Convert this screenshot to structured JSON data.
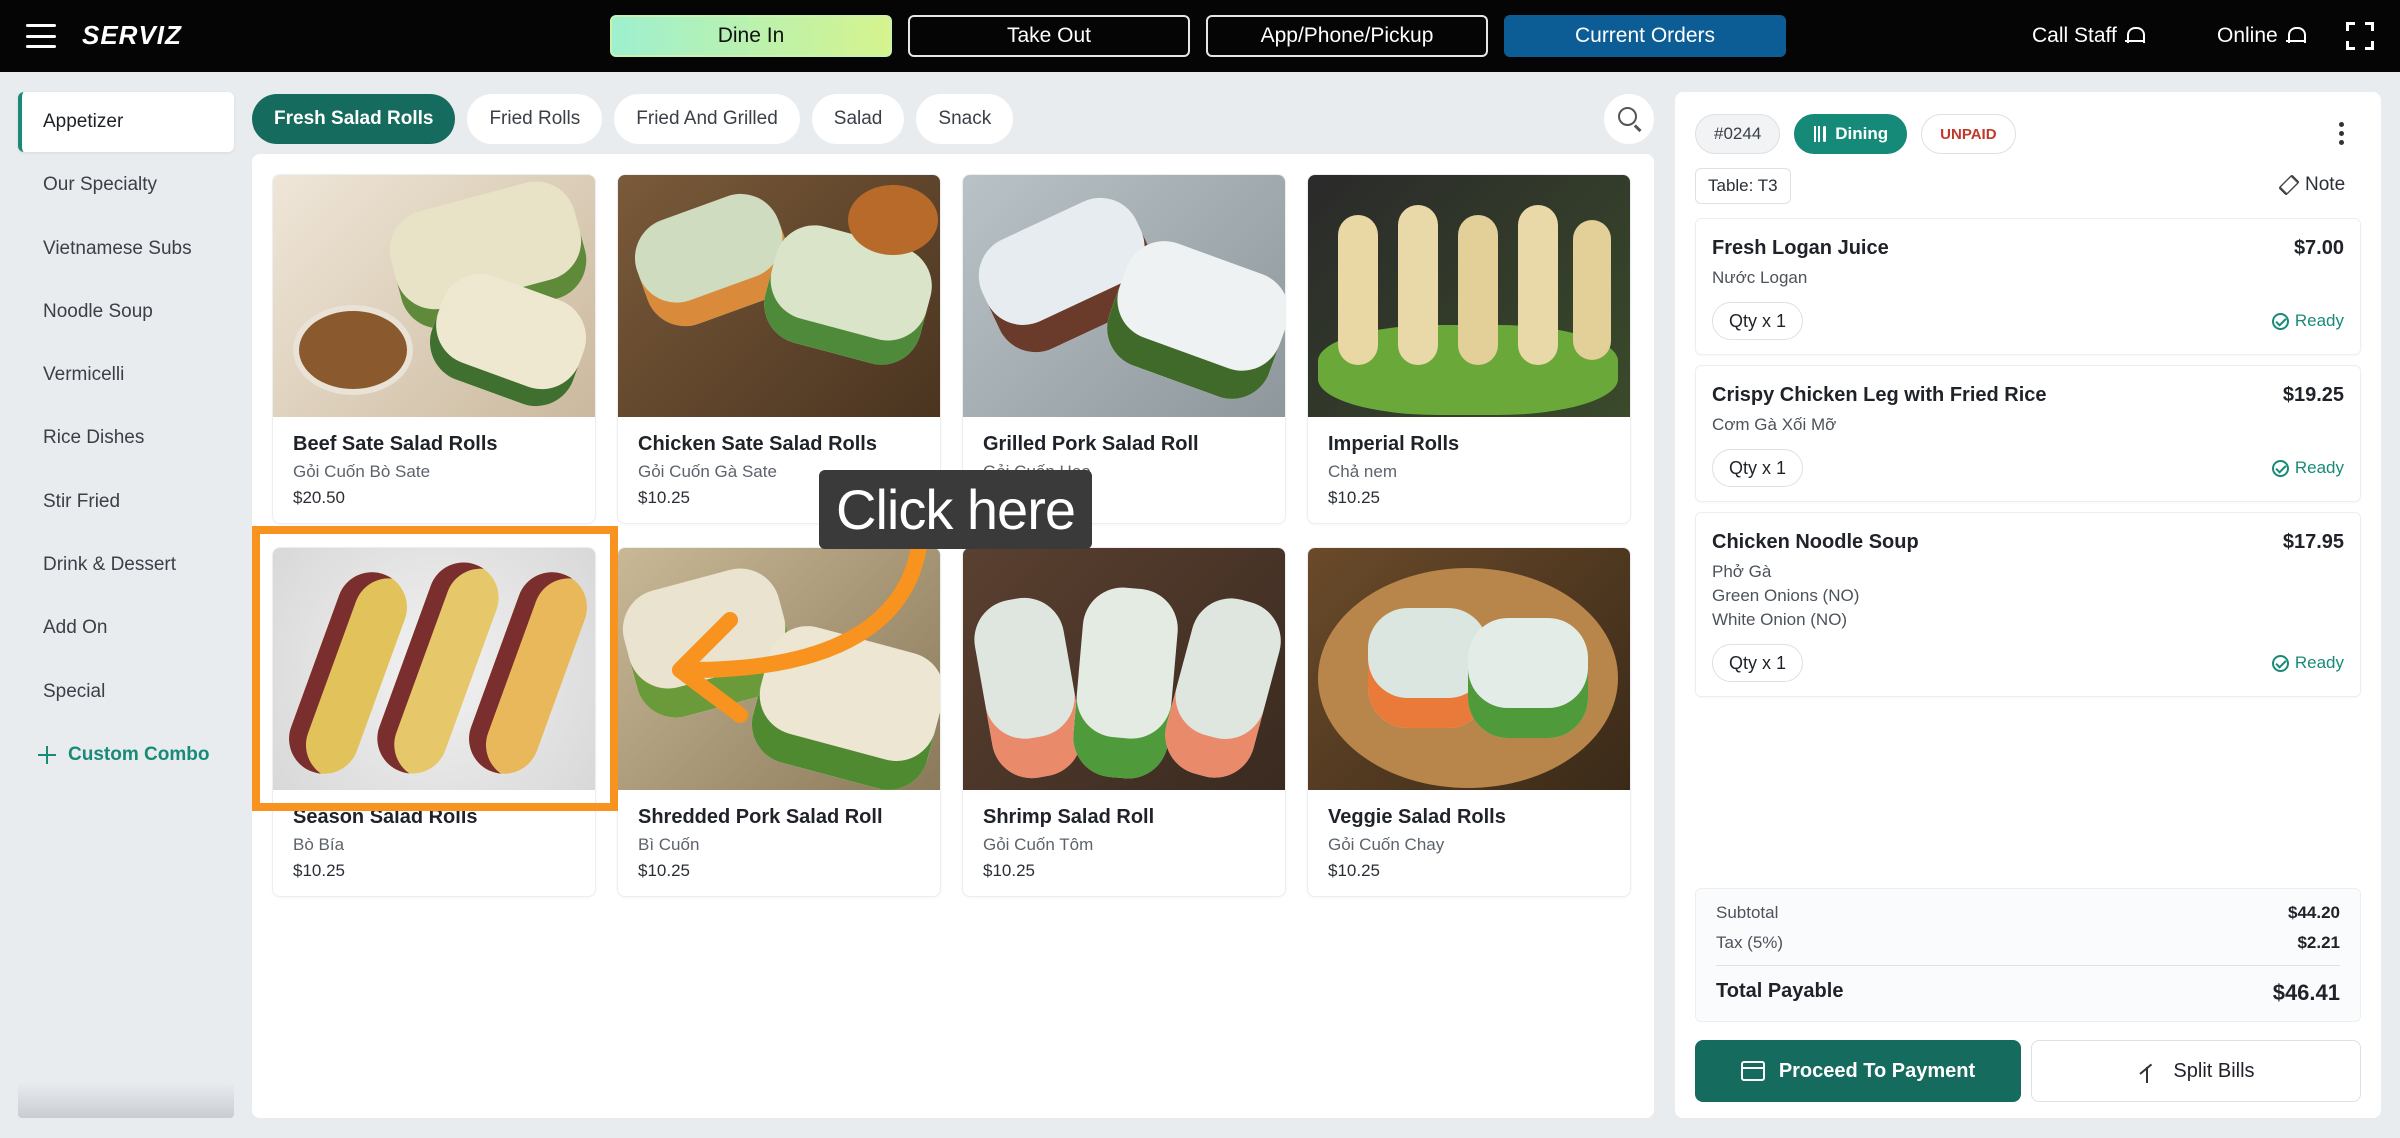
{
  "header": {
    "brand": "SERVIZ",
    "tabs": [
      {
        "label": "Dine In",
        "active": true
      },
      {
        "label": "Take Out",
        "active": false
      },
      {
        "label": "App/Phone/Pickup",
        "active": false
      },
      {
        "label": "Current Orders",
        "active": false
      }
    ],
    "call_staff": "Call Staff",
    "online": "Online"
  },
  "sidebar": {
    "items": [
      {
        "label": "Appetizer",
        "active": true
      },
      {
        "label": "Our Specialty"
      },
      {
        "label": "Vietnamese Subs"
      },
      {
        "label": "Noodle Soup"
      },
      {
        "label": "Vermicelli"
      },
      {
        "label": "Rice Dishes"
      },
      {
        "label": "Stir Fried"
      },
      {
        "label": "Drink & Dessert"
      },
      {
        "label": "Add On"
      },
      {
        "label": "Special"
      }
    ],
    "combo": "Custom Combo"
  },
  "categories": [
    {
      "label": "Fresh Salad Rolls",
      "active": true
    },
    {
      "label": "Fried Rolls"
    },
    {
      "label": "Fried And Grilled"
    },
    {
      "label": "Salad"
    },
    {
      "label": "Snack"
    }
  ],
  "products": [
    {
      "name": "Beef Sate Salad Rolls",
      "sub": "Gỏi Cuốn Bò Sate",
      "price": "$20.50"
    },
    {
      "name": "Chicken Sate Salad Rolls",
      "sub": "Gỏi Cuốn Gà Sate",
      "price": "$10.25"
    },
    {
      "name": "Grilled Pork Salad Roll",
      "sub": "Gỏi Cuốn Heo",
      "price": "$10.25"
    },
    {
      "name": "Imperial Rolls",
      "sub": "Chả nem",
      "price": "$10.25"
    },
    {
      "name": "Season Salad Rolls",
      "sub": "Bò Bía",
      "price": "$10.25"
    },
    {
      "name": "Shredded Pork Salad Roll",
      "sub": "Bì Cuốn",
      "price": "$10.25"
    },
    {
      "name": "Shrimp Salad Roll",
      "sub": "Gỏi Cuốn Tôm",
      "price": "$10.25"
    },
    {
      "name": "Veggie Salad Rolls",
      "sub": "Gỏi Cuốn Chay",
      "price": "$10.25"
    }
  ],
  "overlay": {
    "tooltip": "Click here",
    "highlight_color": "#f7931e"
  },
  "order": {
    "number": "#0244",
    "type": "Dining",
    "status": "UNPAID",
    "table": "Table: T3",
    "note": "Note",
    "items": [
      {
        "name": "Fresh Logan Juice",
        "price": "$7.00",
        "sub": "Nước Logan",
        "mods": [],
        "qty": "Qty x 1",
        "status": "Ready"
      },
      {
        "name": "Crispy Chicken Leg with Fried Rice",
        "price": "$19.25",
        "sub": "Cơm Gà Xối Mỡ",
        "mods": [],
        "qty": "Qty x 1",
        "status": "Ready"
      },
      {
        "name": "Chicken Noodle Soup",
        "price": "$17.95",
        "sub": "Phở Gà",
        "mods": [
          "Green Onions (NO)",
          "White Onion (NO)"
        ],
        "qty": "Qty x 1",
        "status": "Ready"
      }
    ],
    "subtotal_label": "Subtotal",
    "subtotal": "$44.20",
    "tax_label": "Tax (5%)",
    "tax": "$2.21",
    "total_label": "Total Payable",
    "total": "$46.41",
    "pay_label": "Proceed To Payment",
    "split_label": "Split Bills"
  },
  "colors": {
    "accent": "#156b5d",
    "orders_tab": "#0c5d95",
    "unpaid": "#c0392b"
  }
}
